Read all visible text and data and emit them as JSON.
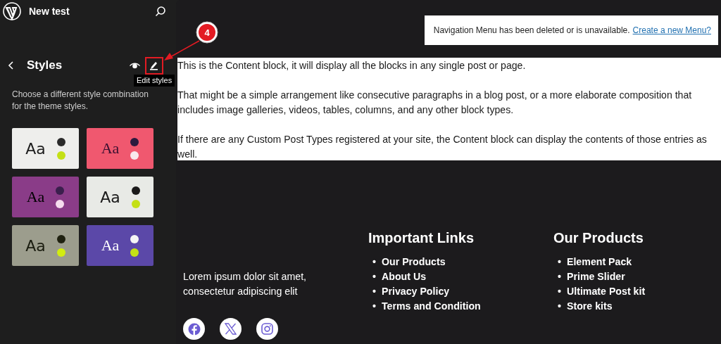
{
  "site": {
    "title": "New test"
  },
  "panel": {
    "title": "Styles",
    "tooltip": "Edit styles",
    "description": "Choose a different style combination for the theme styles."
  },
  "style_variations": [
    {
      "kind": "sans",
      "color": "#eeeeec",
      "sample": {
        "label": "Aa",
        "color": "#1e1e1e"
      },
      "dots": [
        {
          "color": "#2a2a2a"
        },
        {
          "color": "#c4e015"
        }
      ]
    },
    {
      "kind": "serif",
      "color": "#f0586f",
      "sample": {
        "label": "Aa",
        "color": "#3a1030"
      },
      "dots": [
        {
          "color": "#2b1a3e"
        },
        {
          "color": "#f8e8ec"
        }
      ]
    },
    {
      "kind": "serif",
      "color": "#8a3c88",
      "sample": {
        "label": "Aa",
        "color": "#000000"
      },
      "dots": [
        {
          "color": "#3b1f4d"
        },
        {
          "color": "#f6dcef"
        }
      ]
    },
    {
      "kind": "sans",
      "color": "#e8eae6",
      "sample": {
        "label": "Aa",
        "color": "#1a1a1a"
      },
      "dots": [
        {
          "color": "#1a1a1a"
        },
        {
          "color": "#c4e015"
        }
      ]
    },
    {
      "kind": "sans",
      "color": "#9c9d8d",
      "sample": {
        "label": "Aa",
        "color": "#1b1d10"
      },
      "dots": [
        {
          "color": "#1f2110"
        },
        {
          "color": "#d2ec10"
        }
      ]
    },
    {
      "kind": "serif",
      "color": "#5b48a8",
      "sample": {
        "label": "Aa",
        "color": "#ffffff"
      },
      "dots": [
        {
          "color": "#f5f5f5"
        },
        {
          "color": "#c4e015"
        }
      ]
    }
  ],
  "notice": {
    "text": "Navigation Menu has been deleted or is unavailable.",
    "link": "Create a new Menu?"
  },
  "content_block": [
    "This is the Content block, it will display all the blocks in any single post or page.",
    "That might be a simple arrangement like consecutive paragraphs in a blog post, or a more elaborate composition that includes image galleries, videos, tables, columns, and any other block types.",
    "If there are any Custom Post Types registered at your site, the Content block can display the contents of those entries as well."
  ],
  "footer": {
    "about": "Lorem ipsum dolor sit amet, consectetur adipiscing elit",
    "columns": [
      {
        "heading": "Important Links",
        "marker": "•",
        "links": [
          "Our Products",
          "About Us",
          "Privacy Policy",
          "Terms and Condition"
        ]
      },
      {
        "heading": "Our Products",
        "marker": "•",
        "links": [
          "Element Pack",
          "Prime Slider",
          "Ultimate Post kit",
          "Store kits"
        ]
      }
    ],
    "social": [
      {
        "kind": "facebook"
      },
      {
        "kind": "x"
      },
      {
        "kind": "instagram"
      }
    ]
  },
  "annotation": {
    "step": "4"
  }
}
